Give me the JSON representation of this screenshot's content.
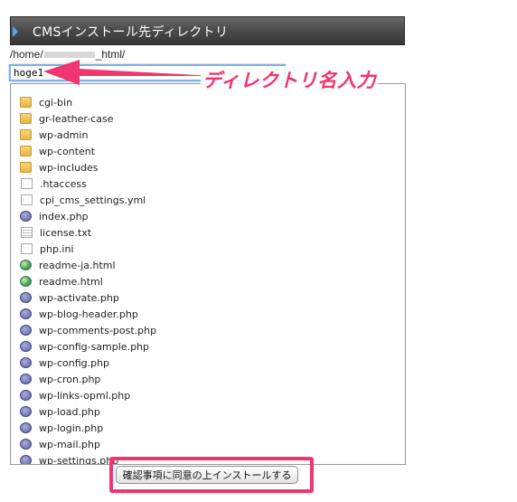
{
  "header": {
    "title": "CMSインストール先ディレクトリ",
    "accent_color": "#5aa6e4"
  },
  "path": {
    "prefix": "/home/",
    "suffix": "_html/"
  },
  "directory_input": {
    "value": "hoge1",
    "placeholder": ""
  },
  "annotation": {
    "label": "ディレクトリ名入力",
    "color": "#f0356f"
  },
  "files": [
    {
      "name": "cgi-bin",
      "icon": "folder-icon"
    },
    {
      "name": "gr-leather-case",
      "icon": "folder-icon"
    },
    {
      "name": "wp-admin",
      "icon": "folder-icon"
    },
    {
      "name": "wp-content",
      "icon": "folder-icon"
    },
    {
      "name": "wp-includes",
      "icon": "folder-icon"
    },
    {
      "name": ".htaccess",
      "icon": "file-icon"
    },
    {
      "name": "cpi_cms_settings.yml",
      "icon": "file-icon"
    },
    {
      "name": "index.php",
      "icon": "php-icon"
    },
    {
      "name": "license.txt",
      "icon": "text-file-icon"
    },
    {
      "name": "php.ini",
      "icon": "file-icon"
    },
    {
      "name": "readme-ja.html",
      "icon": "html-icon"
    },
    {
      "name": "readme.html",
      "icon": "html-icon"
    },
    {
      "name": "wp-activate.php",
      "icon": "php-icon"
    },
    {
      "name": "wp-blog-header.php",
      "icon": "php-icon"
    },
    {
      "name": "wp-comments-post.php",
      "icon": "php-icon"
    },
    {
      "name": "wp-config-sample.php",
      "icon": "php-icon"
    },
    {
      "name": "wp-config.php",
      "icon": "php-icon"
    },
    {
      "name": "wp-cron.php",
      "icon": "php-icon"
    },
    {
      "name": "wp-links-opml.php",
      "icon": "php-icon"
    },
    {
      "name": "wp-load.php",
      "icon": "php-icon"
    },
    {
      "name": "wp-login.php",
      "icon": "php-icon"
    },
    {
      "name": "wp-mail.php",
      "icon": "php-icon"
    },
    {
      "name": "wp-settings.php",
      "icon": "php-icon"
    }
  ],
  "submit": {
    "label": "確認事項に同意の上インストールする"
  }
}
